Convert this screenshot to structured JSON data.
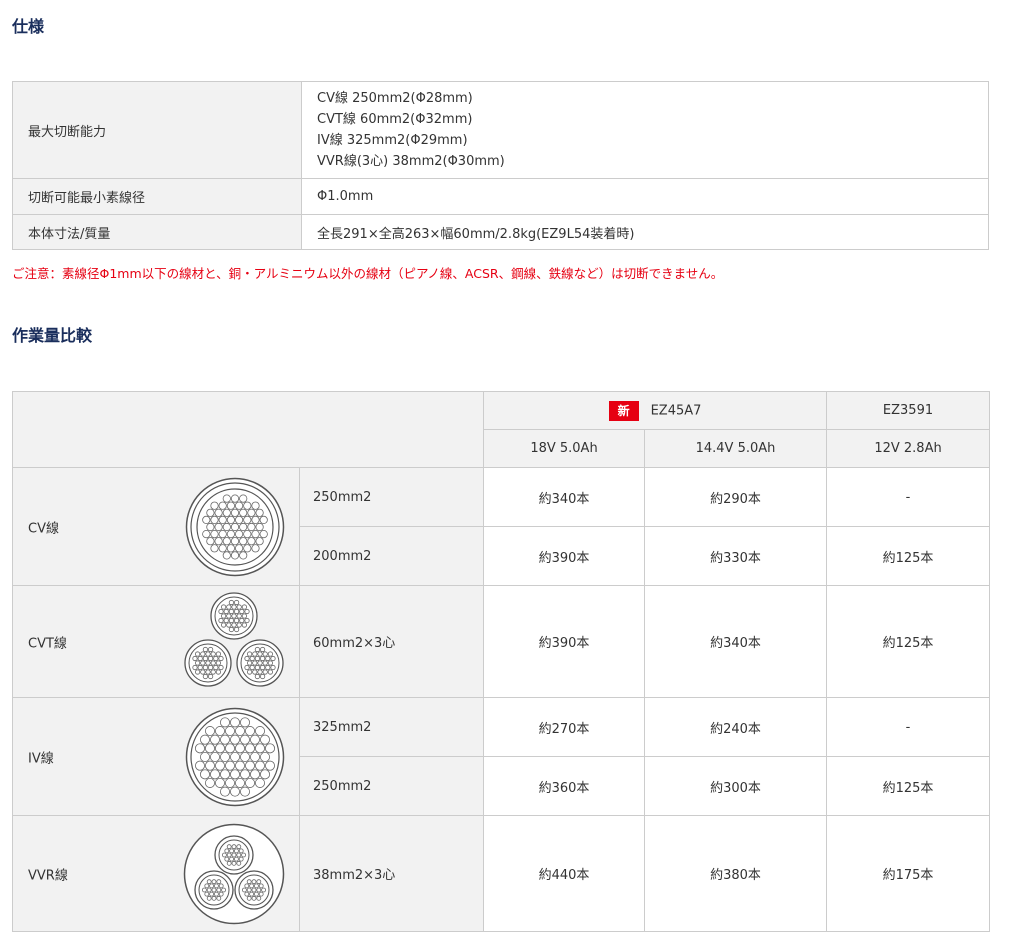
{
  "spec_section": {
    "title": "仕様",
    "rows": [
      {
        "label": "最大切断能力",
        "lines": [
          "CV線 250mm2(Φ28mm)",
          "CVT線 60mm2(Φ32mm)",
          "IV線 325mm2(Φ29mm)",
          "VVR線(3心) 38mm2(Φ30mm)"
        ]
      },
      {
        "label": "切断可能最小素線径",
        "lines": [
          "Φ1.0mm"
        ]
      },
      {
        "label": "本体寸法/質量",
        "lines": [
          "全長291×全高263×幅60mm/2.8kg(EZ9L54装着時)"
        ]
      }
    ],
    "note": "ご注意：素線径Φ1mm以下の線材と、銅・アルミニウム以外の線材（ピアノ線、ACSR、鋼線、鉄線など）は切断できません。"
  },
  "comparison_section": {
    "title": "作業量比較",
    "header": {
      "new_badge": "新",
      "model_a": "EZ45A7",
      "model_b": "EZ3591",
      "battery_a1": "18V 5.0Ah",
      "battery_a2": "14.4V 5.0Ah",
      "battery_b": "12V 2.8Ah"
    },
    "cables": [
      {
        "name": "CV線",
        "icon": "cv-cable-icon",
        "rows": [
          {
            "size": "250mm2",
            "v1": "約340本",
            "v2": "約290本",
            "v3": "-"
          },
          {
            "size": "200mm2",
            "v1": "約390本",
            "v2": "約330本",
            "v3": "約125本"
          }
        ]
      },
      {
        "name": "CVT線",
        "icon": "cvt-cable-icon",
        "rows": [
          {
            "size": "60mm2×3心",
            "v1": "約390本",
            "v2": "約340本",
            "v3": "約125本"
          }
        ]
      },
      {
        "name": "IV線",
        "icon": "iv-cable-icon",
        "rows": [
          {
            "size": "325mm2",
            "v1": "約270本",
            "v2": "約240本",
            "v3": "-"
          },
          {
            "size": "250mm2",
            "v1": "約360本",
            "v2": "約300本",
            "v3": "約125本"
          }
        ]
      },
      {
        "name": "VVR線",
        "icon": "vvr-cable-icon",
        "rows": [
          {
            "size": "38mm2×3心",
            "v1": "約440本",
            "v2": "約380本",
            "v3": "約175本"
          }
        ]
      }
    ]
  }
}
